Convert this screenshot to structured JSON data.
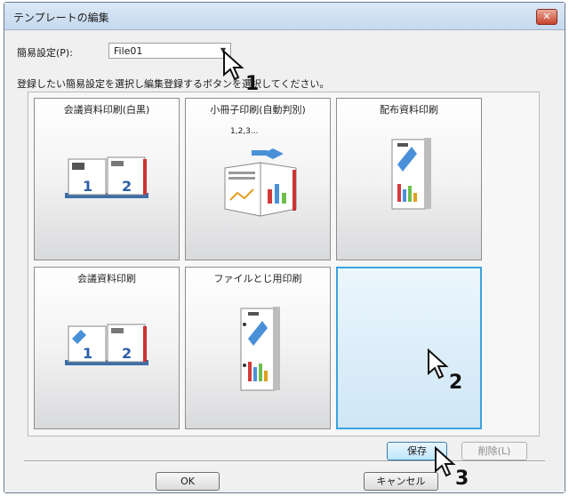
{
  "window": {
    "title": "テンプレートの編集",
    "close_glyph": "✕"
  },
  "preset": {
    "label": "簡易設定(P):",
    "value": "File01"
  },
  "instruction": "登録したい簡易設定を選択し編集登録するボタンを選択してください。",
  "tiles": [
    {
      "label": "会議資料印刷(白黒)"
    },
    {
      "label": "小冊子印刷(自動判別)",
      "counter": "1,2,3..."
    },
    {
      "label": "配布資料印刷"
    },
    {
      "label": "会議資料印刷"
    },
    {
      "label": "ファイルとじ用印刷"
    },
    {
      "label": ""
    }
  ],
  "buttons": {
    "save": "保存",
    "delete": "削除(L)",
    "ok": "OK",
    "cancel": "キャンセル"
  },
  "callouts": [
    "1",
    "2",
    "3"
  ],
  "colors": {
    "selection": "#3aa3e0",
    "accent_blue": "#4a90d9",
    "accent_red": "#d43a3a"
  }
}
